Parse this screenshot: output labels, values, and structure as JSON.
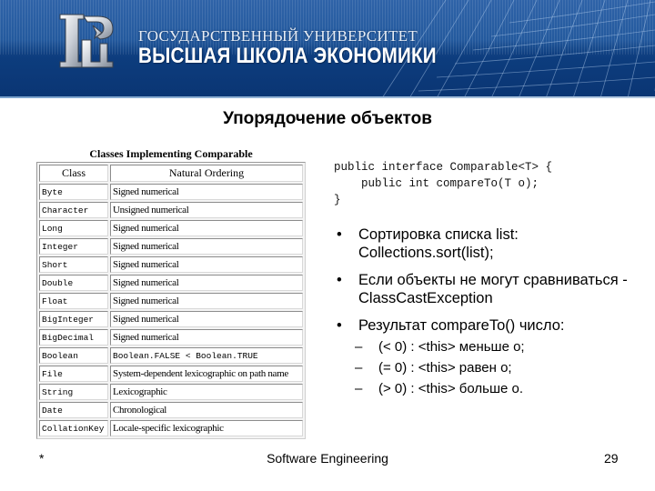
{
  "header": {
    "logo_icon": "hse-logo-icon",
    "university_line1": "ГОСУДАРСТВЕННЫЙ УНИВЕРСИТЕТ",
    "university_line2": "ВЫСШАЯ ШКОЛА ЭКОНОМИКИ"
  },
  "slide": {
    "title": "Упорядочение объектов"
  },
  "table": {
    "caption": "Classes Implementing Comparable",
    "columns": [
      "Class",
      "Natural Ordering"
    ],
    "rows": [
      {
        "class": "Byte",
        "ordering": "Signed numerical"
      },
      {
        "class": "Character",
        "ordering": "Unsigned numerical"
      },
      {
        "class": "Long",
        "ordering": "Signed numerical"
      },
      {
        "class": "Integer",
        "ordering": "Signed numerical"
      },
      {
        "class": "Short",
        "ordering": "Signed numerical"
      },
      {
        "class": "Double",
        "ordering": "Signed numerical"
      },
      {
        "class": "Float",
        "ordering": "Signed numerical"
      },
      {
        "class": "BigInteger",
        "ordering": "Signed numerical"
      },
      {
        "class": "BigDecimal",
        "ordering": "Signed numerical"
      },
      {
        "class": "Boolean",
        "ordering": "Boolean.FALSE < Boolean.TRUE"
      },
      {
        "class": "File",
        "ordering": "System-dependent lexicographic on path name"
      },
      {
        "class": "String",
        "ordering": "Lexicographic"
      },
      {
        "class": "Date",
        "ordering": "Chronological"
      },
      {
        "class": "CollationKey",
        "ordering": "Locale-specific lexicographic"
      }
    ]
  },
  "code": {
    "lines": [
      "public interface Comparable<T> {",
      "    public int compareTo(T o);",
      "}"
    ]
  },
  "bullets": [
    {
      "text": "Сортировка списка list: Collections.sort(list);"
    },
    {
      "text": "Если объекты не могут сравниваться - ClassCastException"
    },
    {
      "text": "Результат compareTo() число:"
    }
  ],
  "sub_bullets": [
    "(< 0) : <this> меньше o;",
    "(= 0) : <this> равен o;",
    "(> 0) : <this> больше o."
  ],
  "bullet_glyph": "•",
  "dash_glyph": "–",
  "footer": {
    "left": "*",
    "center": "Software Engineering",
    "page_number": "29"
  },
  "colors": {
    "banner_blue": "#0b3776",
    "banner_light": "#2f63a8"
  }
}
